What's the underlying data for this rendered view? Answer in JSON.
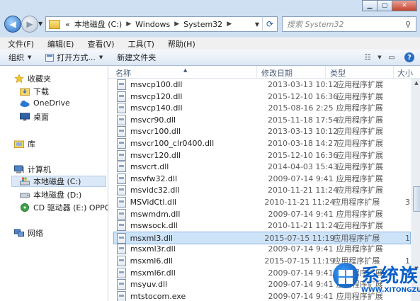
{
  "window": {
    "caption_buttons": [
      "minimize",
      "maximize",
      "close"
    ]
  },
  "address": {
    "overflow": "«",
    "crumbs": [
      "本地磁盘 (C:)",
      "Windows",
      "System32"
    ],
    "search_placeholder": "搜索 System32"
  },
  "menu": {
    "items": [
      "文件(F)",
      "编辑(E)",
      "查看(V)",
      "工具(T)",
      "帮助(H)"
    ]
  },
  "toolbar": {
    "organize": "组织",
    "open_with": "打开方式...",
    "new_folder": "新建文件夹"
  },
  "nav": {
    "favorites": "收藏夹",
    "downloads": "下载",
    "onedrive": "OneDrive",
    "desktop": "桌面",
    "libraries": "库",
    "computer": "计算机",
    "drive_c": "本地磁盘 (C:)",
    "drive_d": "本地磁盘 (D:)",
    "drive_e": "CD 驱动器 (E:) OPPO D",
    "network": "网络"
  },
  "columns": {
    "name": "名称",
    "date": "修改日期",
    "type": "类型",
    "size": "大小"
  },
  "files": [
    {
      "name": "msvcp100.dll",
      "date": "2013-03-13 10:12",
      "type": "应用程序扩展",
      "size": ""
    },
    {
      "name": "msvcp120.dll",
      "date": "2015-12-10 16:36",
      "type": "应用程序扩展",
      "size": ""
    },
    {
      "name": "msvcp140.dll",
      "date": "2015-08-16 2:25",
      "type": "应用程序扩展",
      "size": ""
    },
    {
      "name": "msvcr90.dll",
      "date": "2015-11-18 17:54",
      "type": "应用程序扩展",
      "size": ""
    },
    {
      "name": "msvcr100.dll",
      "date": "2013-03-13 10:12",
      "type": "应用程序扩展",
      "size": ""
    },
    {
      "name": "msvcr100_clr0400.dll",
      "date": "2010-03-18 14:27",
      "type": "应用程序扩展",
      "size": ""
    },
    {
      "name": "msvcr120.dll",
      "date": "2015-12-10 16:36",
      "type": "应用程序扩展",
      "size": ""
    },
    {
      "name": "msvcrt.dll",
      "date": "2014-04-03 15:43",
      "type": "应用程序扩展",
      "size": ""
    },
    {
      "name": "msvfw32.dll",
      "date": "2009-07-14 9:41",
      "type": "应用程序扩展",
      "size": ""
    },
    {
      "name": "msvidc32.dll",
      "date": "2010-11-21 11:24",
      "type": "应用程序扩展",
      "size": ""
    },
    {
      "name": "MSVidCtl.dll",
      "date": "2010-11-21 11:24",
      "type": "应用程序扩展",
      "size": "3"
    },
    {
      "name": "mswmdm.dll",
      "date": "2009-07-14 9:41",
      "type": "应用程序扩展",
      "size": ""
    },
    {
      "name": "mswsock.dll",
      "date": "2010-11-21 11:24",
      "type": "应用程序扩展",
      "size": ""
    },
    {
      "name": "msxml3.dll",
      "date": "2015-07-15 11:19",
      "type": "应用程序扩展",
      "size": "1"
    },
    {
      "name": "msxml3r.dll",
      "date": "2009-07-14 9:41",
      "type": "应用程序扩展",
      "size": ""
    },
    {
      "name": "msxml6.dll",
      "date": "2015-07-15 11:19",
      "type": "应用程序扩展",
      "size": "1"
    },
    {
      "name": "msxml6r.dll",
      "date": "2009-07-14 9:41",
      "type": "应用程序扩展",
      "size": ""
    },
    {
      "name": "msyuv.dll",
      "date": "2009-07-14 9:41",
      "type": "应用程序扩展",
      "size": ""
    },
    {
      "name": "mtstocom.exe",
      "date": "2009-07-14 9:41",
      "type": "应用程序扩展",
      "size": ""
    }
  ],
  "selected_file": "msxml3.dll",
  "watermark": {
    "text": "系统族",
    "url": "WWW.XITONGZU.COM"
  },
  "colors": {
    "selection": "#cde3f8",
    "chrome": "#cfe0f3",
    "watermark": "#0b5fc7"
  }
}
